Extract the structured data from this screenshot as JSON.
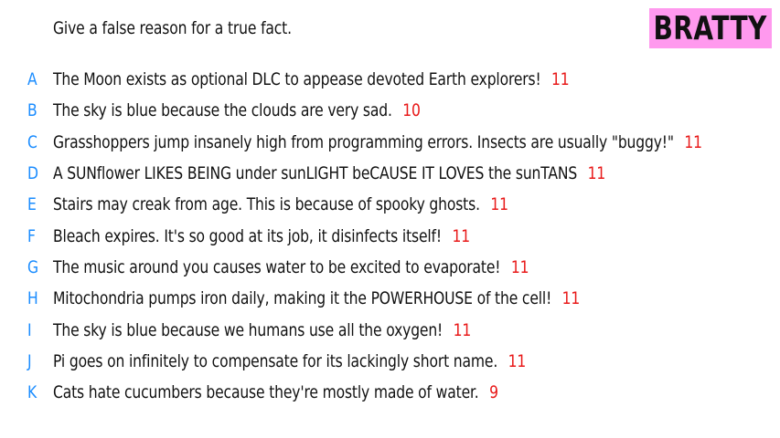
{
  "prompt": "Give a false reason for a true fact.",
  "badge": {
    "label": "BRATTY",
    "color": "#ff99ee"
  },
  "colors": {
    "letter": "#1a8cff",
    "score": "#e81818",
    "text": "#111111"
  },
  "answers": [
    {
      "letter": "A",
      "text": "The Moon exists as optional DLC to appease devoted Earth explorers!",
      "score": "11"
    },
    {
      "letter": "B",
      "text": "The sky is blue because the clouds are very sad.",
      "score": "10"
    },
    {
      "letter": "C",
      "text": "Grasshoppers jump insanely high from programming errors. Insects are usually \"buggy!\"",
      "score": "11"
    },
    {
      "letter": "D",
      "text": "A SUNflower LIKES BEING under sunLIGHT beCAUSE IT LOVES the sunTANS",
      "score": "11"
    },
    {
      "letter": "E",
      "text": "Stairs may creak from age. This is because of spooky ghosts.",
      "score": "11"
    },
    {
      "letter": "F",
      "text": "Bleach expires. It's so good at its job, it disinfects itself!",
      "score": "11"
    },
    {
      "letter": "G",
      "text": "The music around you causes water to be excited to evaporate!",
      "score": "11"
    },
    {
      "letter": "H",
      "text": "Mitochondria pumps iron daily, making it the POWERHOUSE of the cell!",
      "score": "11"
    },
    {
      "letter": "I",
      "text": "The sky is blue because we humans use all the oxygen!",
      "score": "11"
    },
    {
      "letter": "J",
      "text": "Pi goes on infinitely to compensate for its lackingly short name.",
      "score": "11"
    },
    {
      "letter": "K",
      "text": "Cats hate cucumbers because they're mostly made of water.",
      "score": "9"
    }
  ]
}
